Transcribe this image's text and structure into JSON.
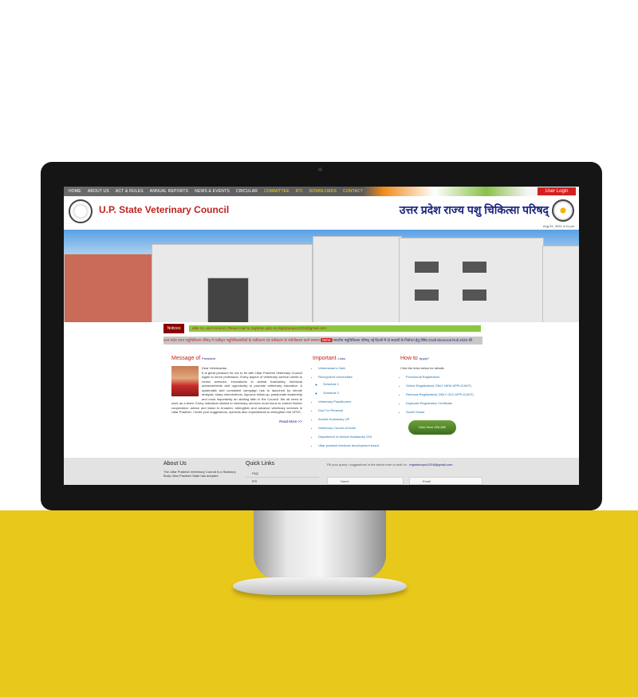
{
  "nav": {
    "items": [
      "HOME",
      "ABOUT US",
      "ACT & RULES",
      "ANNUAL REPORTS",
      "NEWS & EVENTS",
      "CIRCULAR",
      "COMMITTEE",
      "RTI",
      "DOWNLOADS",
      "CONTACT"
    ],
    "login": "User Login"
  },
  "header": {
    "title": "U.P. State Veterinary Council",
    "hindi_title": "उत्तर प्रदेश राज्य पशु चिकित्सा परिषद्",
    "date": "Aug 31, 2021 4:11 pm"
  },
  "notices": {
    "label": "Notices",
    "text": "able no, and email id, Please mail to registrar upvc at registrarupvc2016@gmail.com",
    "ticker_1": "उत्तर प्रदेश राज्य पशुचिकित्सा परिषद् मे पंजीकृत पशुचिकित्साविदों के पंजीकरण एवं पंजीकरण के नवीनीकरण करने सम्बन्ध",
    "ticker_new": "NEW",
    "ticker_2": "भारतीय पशुचिकित्सा परिषद् नई दिल्ली में दो सदस्यों के निर्वाचन हेतु प्रेषित Draft Electoral Roll 2020 की"
  },
  "message": {
    "title": "Message of",
    "subtitle": "President",
    "greeting": "Dear Veterinarian,",
    "body": "It is great pleasure for me to be with Uttar Pradesh Veterinary Council Again to serve profession. Every aspect of veterinary service needs to renew avenues, innovations in animal husbandry, technical advancements and opportunity to promote veterinary education. A systematic and consistent campaign has to launched by minute analysis, sharp interventions, rigorous follow-up, passionate leadership and most importantly an abiding faith in the Council. We all need to work as a team. Every individual related to veterinary services must focus to extend his/her cooperation, advice and vision to broaden, strengthen and advance veterinary services in Uttar Pradesh. I invite your suggestions, opinions also expectations to strengthen the UPVC.",
    "read_more": "Read More >>"
  },
  "important": {
    "title": "Important",
    "subtitle": "Links",
    "links": [
      "Veterinarian's Oath",
      "Recognized Universities",
      "Veterinary Practitioners",
      "Dos For Renewal",
      "Animal Husbandry UP",
      "Veterinary Council of India",
      "Department of Animal Husbandry GOI",
      "Uttar pradesh livestock development board"
    ],
    "sub_links": [
      "Schedule 1",
      "Schedule 2"
    ]
  },
  "howto": {
    "title": "How to",
    "subtitle": "Apply?",
    "intro": "Click the links below for details",
    "links": [
      "Provisional Registration",
      "Online Registration( ONLY NEW APPLICANT)",
      "Renewal Registration( ONLY OLD APPLICANT)",
      "Duplicate Registration Certificate",
      "Guest House"
    ],
    "button": "Click Here ONLINE REGISTRATION"
  },
  "footer": {
    "about_title": "About Us",
    "about_text": "The Uttar Pradesh Veterinary Council is a Statutory Body Uttar Pradesh State has adopted",
    "links_title": "Quick Links",
    "links": [
      "FAQ",
      "RTI"
    ],
    "query_text": "Fill your query / suggestions in the below form to mail on :",
    "query_email": "registrarupvc2016@gmail.com",
    "name_placeholder": "Name",
    "email_placeholder": "Email"
  }
}
